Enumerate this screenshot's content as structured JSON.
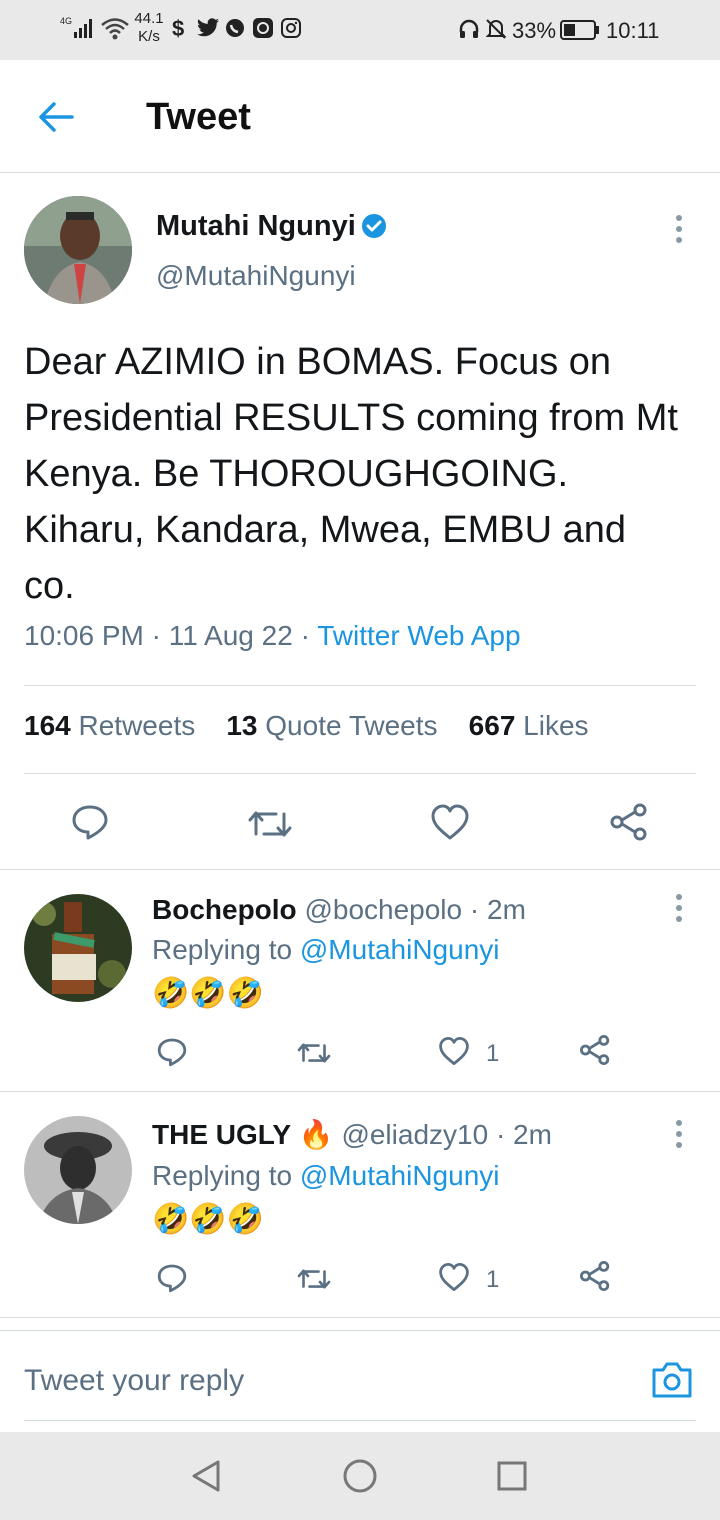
{
  "status_bar": {
    "network": "4G",
    "speed_value": "44.1",
    "speed_unit": "K/s",
    "battery": "33%",
    "time": "10:11"
  },
  "header": {
    "title": "Tweet"
  },
  "tweet": {
    "author_name": "Mutahi Ngunyi",
    "author_handle": "@MutahiNgunyi",
    "text": "Dear AZIMIO in BOMAS. Focus on Presidential RESULTS coming from Mt Kenya. Be THOROUGHGOING. Kiharu, Kandara, Mwea, EMBU and co.",
    "time": "10:06 PM",
    "date": "11 Aug 22",
    "source": "Twitter Web App",
    "sep": "·",
    "retweets_count": "164",
    "retweets_label": "Retweets",
    "quote_count": "13",
    "quote_label": "Quote Tweets",
    "likes_count": "667",
    "likes_label": "Likes"
  },
  "replies": [
    {
      "name": "Bochepolo",
      "handle": "@bochepolo",
      "age": "· 2m",
      "replying_prefix": "Replying to",
      "replying_handle": "@MutahiNgunyi",
      "text": "🤣🤣🤣",
      "like_count": "1"
    },
    {
      "name": "THE UGLY",
      "name_emoji": "🔥",
      "handle": "@eliadzy10",
      "age": "· 2m",
      "replying_prefix": "Replying to",
      "replying_handle": "@MutahiNgunyi",
      "text": "🤣🤣🤣",
      "like_count": "1"
    }
  ],
  "composer": {
    "placeholder": "Tweet your reply"
  },
  "colors": {
    "accent": "#1b95e0",
    "muted": "#5b7083",
    "text": "#14171a"
  }
}
